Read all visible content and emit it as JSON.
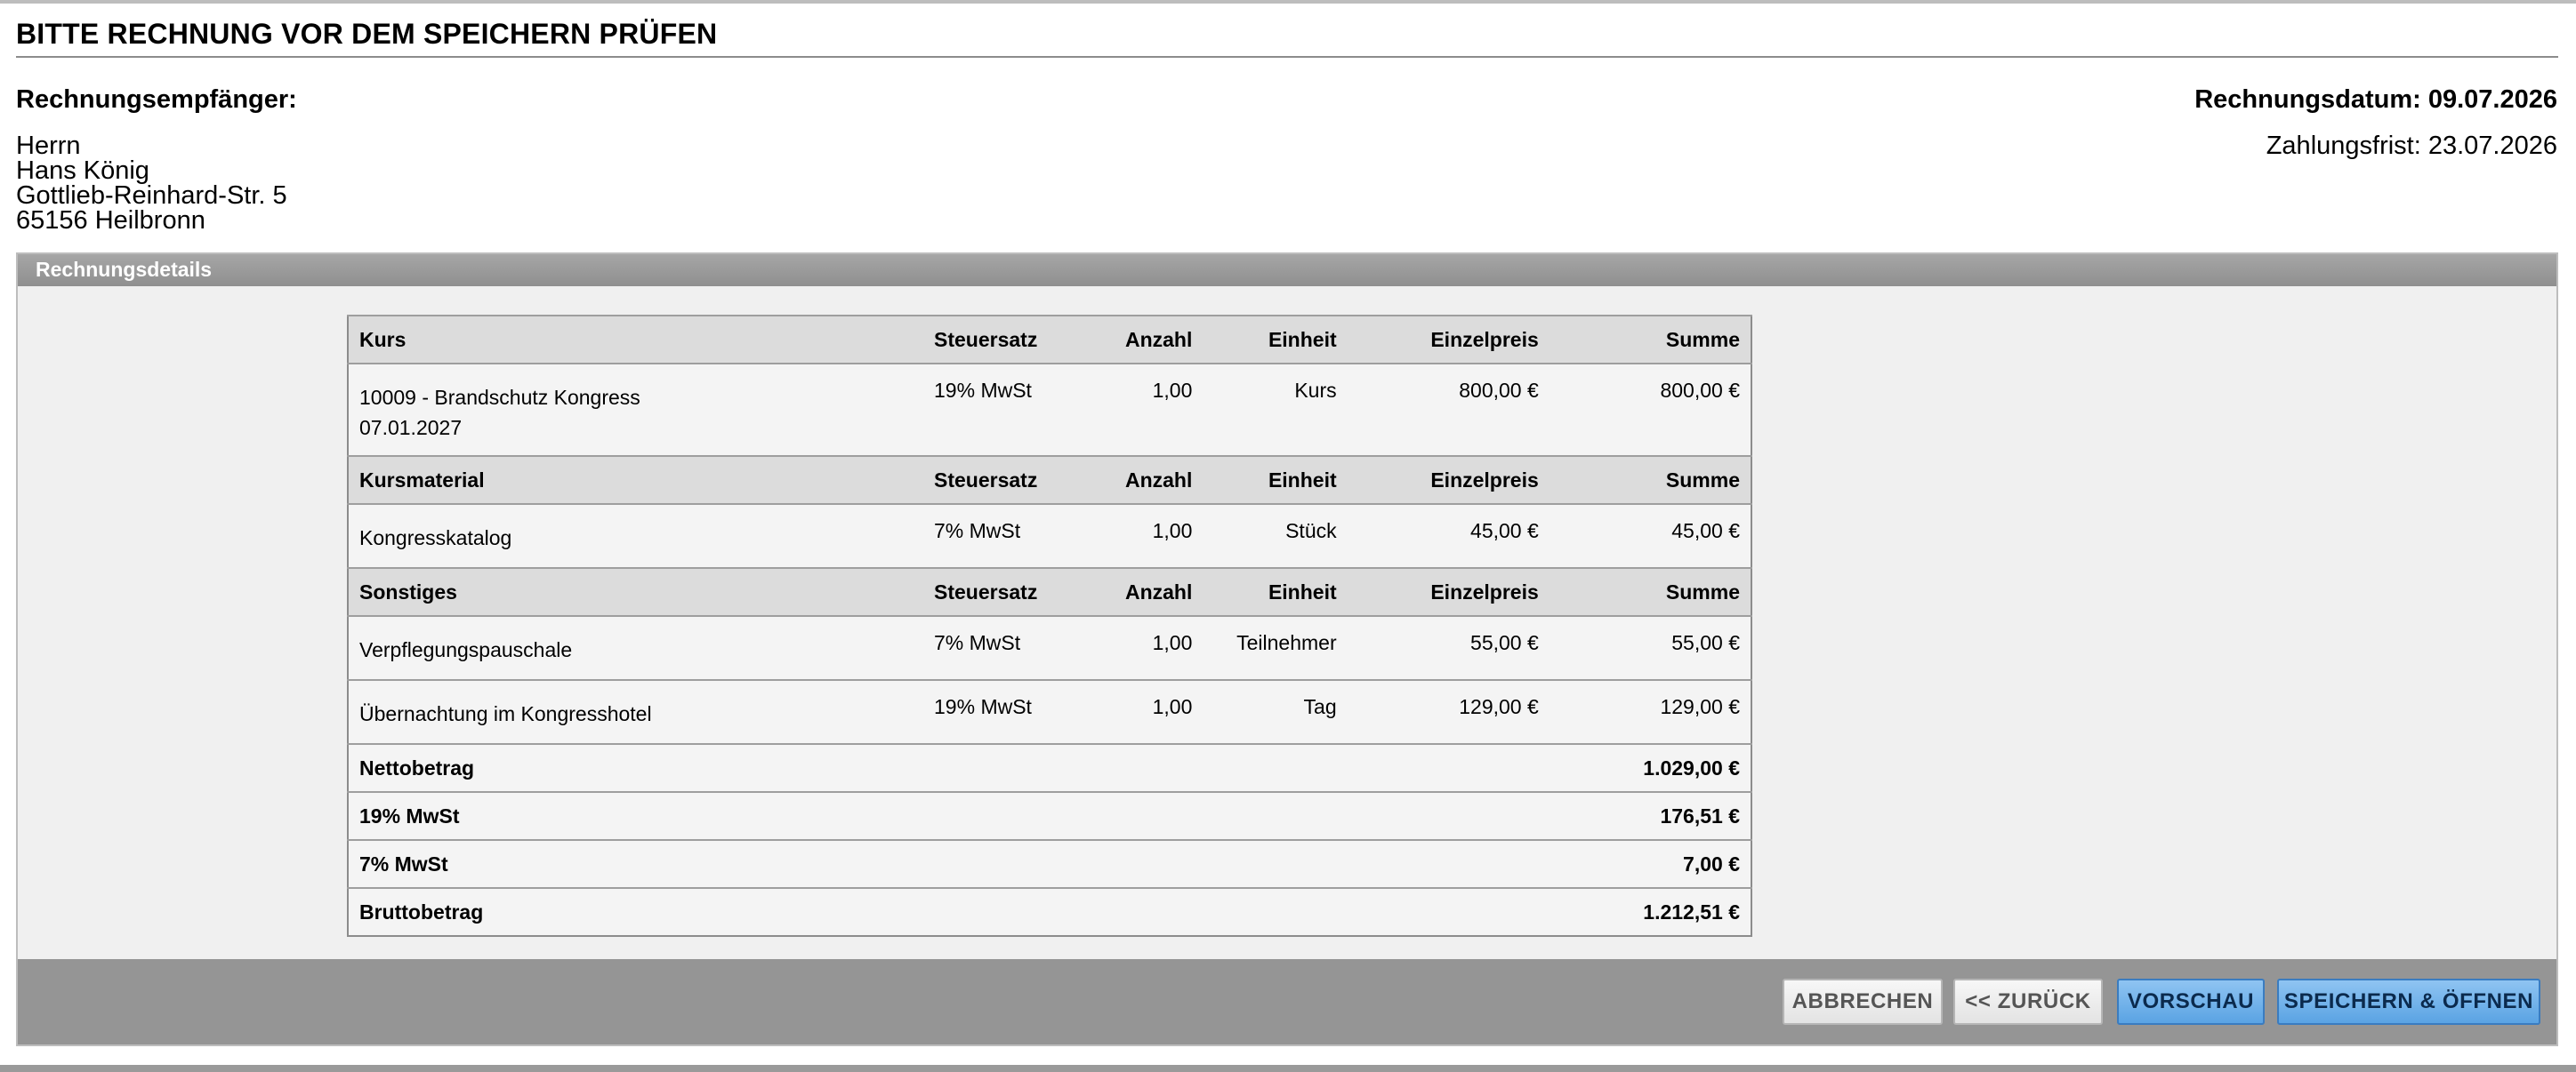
{
  "page": {
    "title": "BITTE RECHNUNG VOR DEM SPEICHERN PRÜFEN"
  },
  "recipient": {
    "heading": "Rechnungsempfänger:",
    "salutation": "Herrn",
    "name": "Hans König",
    "street": "Gottlieb-Reinhard-Str. 5",
    "city": "65156 Heilbronn"
  },
  "invoice": {
    "date_label": "Rechnungsdatum: 09.07.2026",
    "due_label": "Zahlungsfrist: 23.07.2026"
  },
  "panel": {
    "title": "Rechnungsdetails"
  },
  "columns": {
    "tax": "Steuersatz",
    "qty": "Anzahl",
    "unit": "Einheit",
    "price": "Einzelpreis",
    "sum": "Summe"
  },
  "sections": [
    {
      "title": "Kurs",
      "items": [
        {
          "desc_line1": "10009 - Brandschutz Kongress",
          "desc_line2": "07.01.2027",
          "tax": "19% MwSt",
          "qty": "1,00",
          "unit": "Kurs",
          "price": "800,00 €",
          "sum": "800,00 €"
        }
      ]
    },
    {
      "title": "Kursmaterial",
      "items": [
        {
          "desc_line1": "Kongresskatalog",
          "tax": "7% MwSt",
          "qty": "1,00",
          "unit": "Stück",
          "price": "45,00 €",
          "sum": "45,00 €"
        }
      ]
    },
    {
      "title": "Sonstiges",
      "items": [
        {
          "desc_line1": "Verpflegungspauschale",
          "tax": "7% MwSt",
          "qty": "1,00",
          "unit": "Teilnehmer",
          "price": "55,00 €",
          "sum": "55,00 €"
        },
        {
          "desc_line1": "Übernachtung im Kongresshotel",
          "tax": "19% MwSt",
          "qty": "1,00",
          "unit": "Tag",
          "price": "129,00 €",
          "sum": "129,00 €"
        }
      ]
    }
  ],
  "totals": [
    {
      "label": "Nettobetrag",
      "value": "1.029,00 €"
    },
    {
      "label": "19% MwSt",
      "value": "176,51 €"
    },
    {
      "label": "7% MwSt",
      "value": "7,00 €"
    },
    {
      "label": "Bruttobetrag",
      "value": "1.212,51 €"
    }
  ],
  "buttons": {
    "cancel": "ABBRECHEN",
    "back": "<< ZURÜCK",
    "preview": "VORSCHAU",
    "save_open": "SPEICHERN & ÖFFNEN"
  },
  "colors": {
    "primary_button": "#5aa3e3",
    "panel_header": "#959595"
  }
}
